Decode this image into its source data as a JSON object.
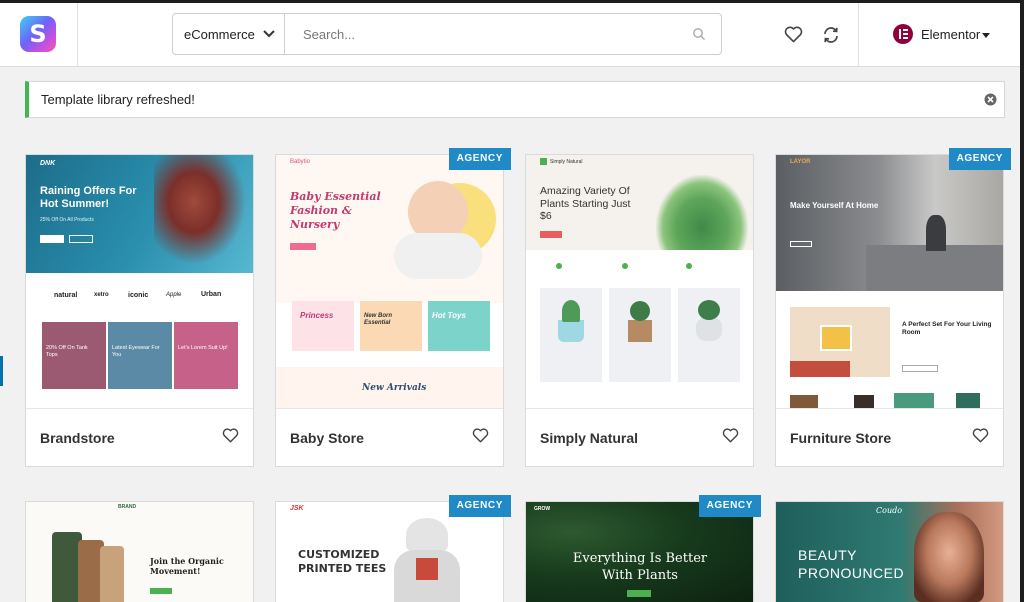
{
  "header": {
    "category": "eCommerce",
    "search_placeholder": "Search...",
    "account_name": "Elementor"
  },
  "notice": {
    "message": "Template library refreshed!"
  },
  "badge_label": "AGENCY",
  "cards": [
    {
      "title": "Brandstore",
      "preview": {
        "brand": "DNK",
        "hero_title": "Raining Offers For Hot Summer!",
        "hero_sub": "25% Off On All Products",
        "logos": [
          "natural",
          "xetro",
          "iconic",
          "Apple",
          "Urban"
        ],
        "tiles": [
          "20% Off On Tank Tops",
          "Latest Eyewear For You",
          "Let's Lorem Suit Up!"
        ]
      }
    },
    {
      "title": "Baby Store",
      "preview": {
        "brand": "Babytio",
        "hero_title": "Baby Essential Fashion & Nursery",
        "tiles": [
          "Princess",
          "New Born Essential",
          "Hot Toys"
        ],
        "section": "New Arrivals"
      }
    },
    {
      "title": "Simply Natural",
      "preview": {
        "brand": "Simply Natural",
        "hero_title": "Amazing Variety Of Plants Starting Just $6"
      }
    },
    {
      "title": "Furniture Store",
      "preview": {
        "brand": "LAYOR",
        "hero_title": "Make Yourself At Home",
        "sub_title": "A Perfect Set For Your Living Room"
      }
    },
    {
      "title": "",
      "preview": {
        "brand": "BRAND",
        "hero_title": "Join the Organic Movement!"
      }
    },
    {
      "title": "",
      "preview": {
        "brand": "JSK",
        "hero_title": "CUSTOMIZED PRINTED TEES"
      }
    },
    {
      "title": "",
      "preview": {
        "brand": "GROW",
        "hero_title": "Everything Is Better With Plants"
      }
    },
    {
      "title": "",
      "preview": {
        "brand": "Coudo",
        "hero_title": "BEAUTY PRONOUNCED"
      }
    }
  ],
  "colors": {
    "notice_accent": "#46b450",
    "agency_badge": "#1f8ac6",
    "elementor_badge": "#92003b"
  }
}
